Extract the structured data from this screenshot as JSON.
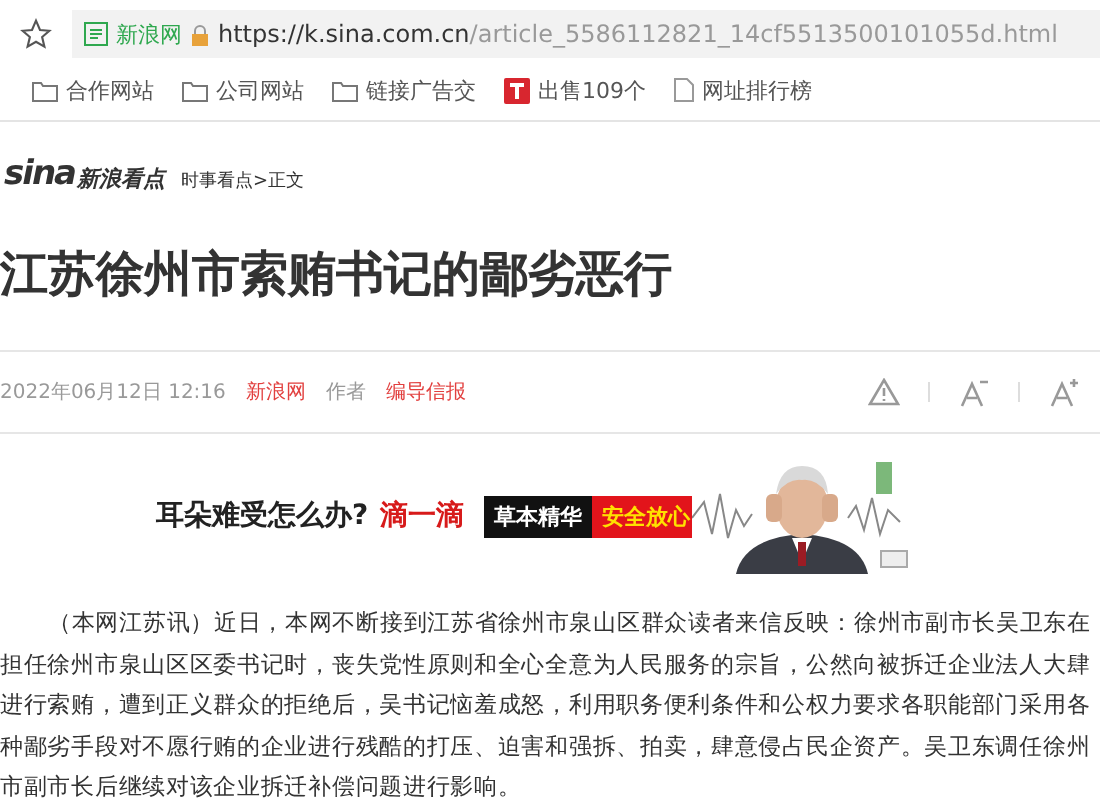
{
  "address_bar": {
    "site_badge": "新浪网",
    "url_host": "https://k.sina.com.cn",
    "url_path": "/article_5586112821_14cf5513500101055d.html"
  },
  "bookmarks": [
    {
      "kind": "folder",
      "label": "合作网站"
    },
    {
      "kind": "folder",
      "label": "公司网站"
    },
    {
      "kind": "folder",
      "label": "链接广告交"
    },
    {
      "kind": "brand",
      "label": "出售109个"
    },
    {
      "kind": "page",
      "label": "网址排行榜"
    }
  ],
  "header": {
    "logo_text": "sina",
    "channel": "新浪看点",
    "breadcrumb": "时事看点>正文"
  },
  "article": {
    "title": "江苏徐州市索贿书记的鄙劣恶行",
    "date": "2022年06月12日 12:16",
    "source": "新浪网",
    "author_label": "作者",
    "report_link": "编导信报",
    "ad": {
      "question": "耳朵难受怎么办?",
      "slogan": "滴一滴",
      "tag_1": "草本精华",
      "tag_2": "安全放心"
    },
    "paragraph": [
      "（本网江苏讯）近日，本网不断接到江苏省徐州市泉山区群众读者来信反映：徐州市副市长吴卫东在",
      "担任徐州市泉山区区委书记时，丧失党性原则和全心全意为人民服务的宗旨，公然向被拆迁企业法人大肆",
      "进行索贿，遭到正义群众的拒绝后，吴书记恼羞成怒，利用职务便利条件和公权力要求各职能部门采用各",
      "种鄙劣手段对不愿行贿的企业进行残酷的打压、迫害和强拆、拍卖，肆意侵占民企资产。吴卫东调任徐州",
      "市副市长后继续对该企业拆迁补偿问题进行影响。"
    ]
  }
}
